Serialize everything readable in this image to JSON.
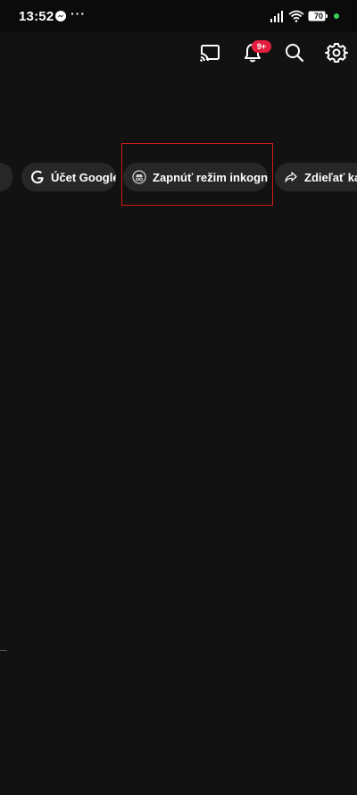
{
  "status_bar": {
    "time": "13:52",
    "overflow_dots": "···",
    "battery_level": "70",
    "icons": [
      "messenger-icon",
      "signal-icon",
      "wifi-icon",
      "battery-icon",
      "charging-dot"
    ]
  },
  "top_bar": {
    "icons": [
      "cast-icon",
      "bell-icon",
      "search-icon",
      "gear-icon"
    ],
    "notification_badge": "9+"
  },
  "chips": [
    {
      "label": "Účet Google",
      "icon": "google-icon"
    },
    {
      "label": "Zapnúť režim inkognito",
      "icon": "incognito-icon"
    },
    {
      "label": "Zdieľať kanál",
      "icon": "share-icon"
    }
  ],
  "colors": {
    "background": "#121212",
    "chip_background": "#272727",
    "badge": "#e41e3f",
    "highlight": "#d11a1a",
    "charging": "#3ad35a"
  }
}
